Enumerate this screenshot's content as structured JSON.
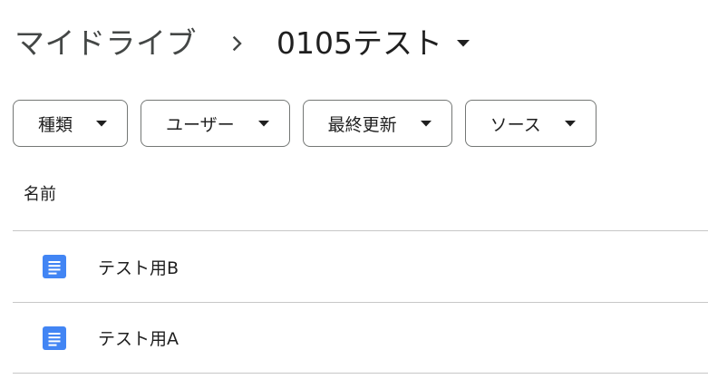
{
  "breadcrumb": {
    "root": "マイドライブ",
    "current": "0105テスト",
    "separator_icon": "chevron-right-icon",
    "caret_icon": "caret-down-icon"
  },
  "filters": [
    {
      "label": "種類",
      "icon": "caret-down-icon"
    },
    {
      "label": "ユーザー",
      "icon": "caret-down-icon"
    },
    {
      "label": "最終更新",
      "icon": "caret-down-icon"
    },
    {
      "label": "ソース",
      "icon": "caret-down-icon"
    }
  ],
  "table": {
    "column_name": "名前",
    "rows": [
      {
        "name": "テスト用B",
        "icon": "google-docs-icon"
      },
      {
        "name": "テスト用A",
        "icon": "google-docs-icon"
      }
    ]
  },
  "colors": {
    "docs_blue": "#4285f4",
    "text_primary": "#1f1f1f",
    "text_secondary": "#444746",
    "border": "#747775",
    "divider": "#c7c7c7"
  }
}
